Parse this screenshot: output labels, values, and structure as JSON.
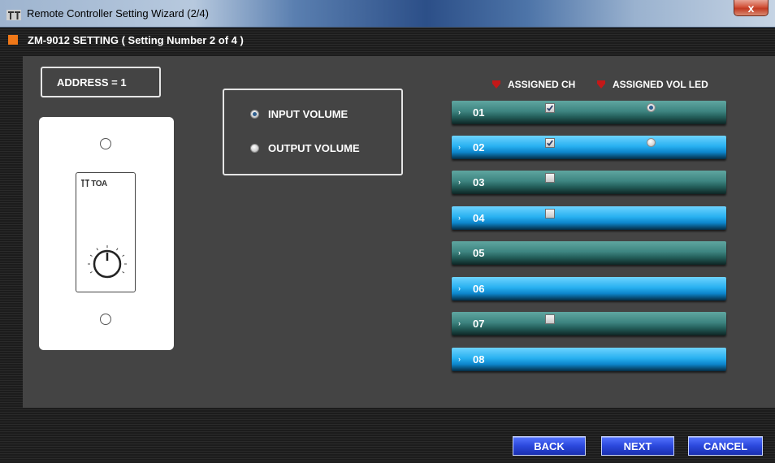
{
  "window": {
    "title": "Remote Controller Setting Wizard (2/4)",
    "close_label": "x"
  },
  "section": {
    "title": "ZM-9012 SETTING  ( Setting Number 2 of 4 )"
  },
  "address": {
    "label": "ADDRESS = 1"
  },
  "device": {
    "brand": "TOA"
  },
  "volume": {
    "options": [
      {
        "label": "INPUT VOLUME",
        "selected": true
      },
      {
        "label": "OUTPUT VOLUME",
        "selected": false
      }
    ]
  },
  "legend": {
    "assigned_ch": "ASSIGNED CH",
    "assigned_vol_led": "ASSIGNED VOL LED",
    "marker_color": "#c41818"
  },
  "channels": [
    {
      "number": "01",
      "style": "teal",
      "has_checkbox": true,
      "checked": true,
      "has_led": true,
      "led_selected": true
    },
    {
      "number": "02",
      "style": "blue",
      "has_checkbox": true,
      "checked": true,
      "has_led": true,
      "led_selected": false
    },
    {
      "number": "03",
      "style": "teal",
      "has_checkbox": true,
      "checked": false,
      "has_led": false,
      "led_selected": false
    },
    {
      "number": "04",
      "style": "blue",
      "has_checkbox": true,
      "checked": false,
      "has_led": false,
      "led_selected": false
    },
    {
      "number": "05",
      "style": "teal",
      "has_checkbox": false,
      "checked": false,
      "has_led": false,
      "led_selected": false
    },
    {
      "number": "06",
      "style": "blue",
      "has_checkbox": false,
      "checked": false,
      "has_led": false,
      "led_selected": false
    },
    {
      "number": "07",
      "style": "teal",
      "has_checkbox": true,
      "checked": false,
      "has_led": false,
      "led_selected": false
    },
    {
      "number": "08",
      "style": "blue",
      "has_checkbox": false,
      "checked": false,
      "has_led": false,
      "led_selected": false
    }
  ],
  "buttons": {
    "back": "BACK",
    "next": "NEXT",
    "cancel": "CANCEL"
  },
  "colors": {
    "accent_orange": "#f07818",
    "panel_bg": "#444444",
    "teal_bar": "#3d8480",
    "blue_bar": "#28b0f0",
    "button_blue": "#2b48dc"
  }
}
